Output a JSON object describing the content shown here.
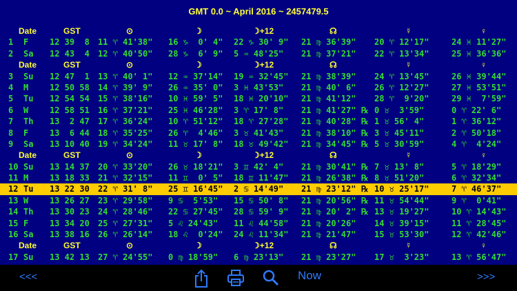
{
  "title": "GMT 0.0 ~ April 2016 ~ 2457479.5",
  "header": {
    "date": "Date",
    "gst": "GST",
    "sun": "⊙",
    "moon": "☽",
    "moon12": "☽+12",
    "node": "☊",
    "mercury": "☿",
    "venus": "♀"
  },
  "rows": [
    {
      "type": "header"
    },
    {
      "type": "data",
      "day": "1",
      "dow": "F",
      "gst": "12 39  8",
      "sun": "11 ♈ 41'38\"",
      "moon": "16 ♑  0' 4\"",
      "moon12": "22 ♑ 30' 9\"",
      "node": "21 ♍ 36'39\"",
      "mercury": "20 ♈ 12'17\"",
      "venus": "24 ♓ 11'27\""
    },
    {
      "type": "data",
      "day": "2",
      "dow": "Sa",
      "gst": "12 43  4",
      "sun": "12 ♈ 40'50\"",
      "moon": "28 ♑  6' 9\"",
      "moon12": "5 ♒ 48'25\"",
      "node": "21 ♍ 37'21\"",
      "mercury": "22 ♈ 13'34\"",
      "venus": "25 ♓ 36'36\""
    },
    {
      "type": "header"
    },
    {
      "type": "data",
      "day": "3",
      "dow": "Su",
      "gst": "12 47  1",
      "sun": "13 ♈ 40' 1\"",
      "moon": "12 ♒ 37'14\"",
      "moon12": "19 ♒ 32'45\"",
      "node": "21 ♍ 38'39\"",
      "mercury": "24 ♈ 13'45\"",
      "venus": "26 ♓ 39'44\""
    },
    {
      "type": "data",
      "day": "4",
      "dow": "M",
      "gst": "12 50 58",
      "sun": "14 ♈ 39' 9\"",
      "moon": "26 ♒ 35' 0\"",
      "moon12": "3 ♓ 43'53\"",
      "node": "21 ♍ 40' 6\"",
      "mercury": "26 ♈ 12'27\"",
      "venus": "27 ♓ 53'51\""
    },
    {
      "type": "data",
      "day": "5",
      "dow": "Tu",
      "gst": "12 54 54",
      "sun": "15 ♈ 38'16\"",
      "moon": "10 ♓ 59' 5\"",
      "moon12": "18 ♓ 20'10\"",
      "node": "21 ♍ 41'12\"",
      "mercury": "28 ♈  9'20\"",
      "venus": "29 ♓  7'59\""
    },
    {
      "type": "data",
      "day": "6",
      "dow": "W",
      "gst": "12 58 51",
      "sun": "16 ♈ 37'21\"",
      "moon": "25 ♓ 46'28\"",
      "moon12": "3 ♈ 17' 8\"",
      "node": "21 ♍ 41'27\" ℞",
      "mercury": "0 ♉  3'59\"",
      "venus": "0 ♈ 22' 6\""
    },
    {
      "type": "data",
      "day": "7",
      "dow": "Th",
      "gst": "13  2 47",
      "sun": "17 ♈ 36'24\"",
      "moon": "10 ♈ 51'12\"",
      "moon12": "18 ♈ 27'28\"",
      "node": "21 ♍ 40'28\" ℞",
      "mercury": "1 ♉ 56' 4\"",
      "venus": "1 ♈ 36'12\""
    },
    {
      "type": "data",
      "day": "8",
      "dow": "F",
      "gst": "13  6 44",
      "sun": "18 ♈ 35'25\"",
      "moon": "26 ♈  4'46\"",
      "moon12": "3 ♉ 41'43\"",
      "node": "21 ♍ 38'10\" ℞",
      "mercury": "3 ♉ 45'11\"",
      "venus": "2 ♈ 50'18\""
    },
    {
      "type": "data",
      "day": "9",
      "dow": "Sa",
      "gst": "13 10 40",
      "sun": "19 ♈ 34'24\"",
      "moon": "11 ♉ 17' 8\"",
      "moon12": "18 ♉ 49'42\"",
      "node": "21 ♍ 34'45\" ℞",
      "mercury": "5 ♉ 30'59\"",
      "venus": "4 ♈  4'24\""
    },
    {
      "type": "header"
    },
    {
      "type": "data",
      "day": "10",
      "dow": "Su",
      "gst": "13 14 37",
      "sun": "20 ♈ 33'20\"",
      "moon": "26 ♉ 18'21\"",
      "moon12": "3 ♊ 42' 4\"",
      "node": "21 ♍ 30'41\" ℞",
      "mercury": "7 ♉ 13' 8\"",
      "venus": "5 ♈ 18'29\""
    },
    {
      "type": "data",
      "day": "11",
      "dow": "M",
      "gst": "13 18 33",
      "sun": "21 ♈ 32'15\"",
      "moon": "11 ♊  0' 5\"",
      "moon12": "18 ♊ 11'47\"",
      "node": "21 ♍ 26'38\" ℞",
      "mercury": "8 ♉ 51'20\"",
      "venus": "6 ♈ 32'34\""
    },
    {
      "type": "data",
      "highlight": true,
      "day": "12",
      "dow": "Tu",
      "gst": "13 22 30",
      "sun": "22 ♈ 31' 8\"",
      "moon": "25 ♊ 16'45\"",
      "moon12": "2 ♋ 14'49\"",
      "node": "21 ♍ 23'12\" ℞",
      "mercury": "10 ♉ 25'17\"",
      "venus": "7 ♈ 46'37\""
    },
    {
      "type": "data",
      "day": "13",
      "dow": "W",
      "gst": "13 26 27",
      "sun": "23 ♈ 29'58\"",
      "moon": "9 ♋  5'53\"",
      "moon12": "15 ♋ 50' 8\"",
      "node": "21 ♍ 20'56\" ℞",
      "mercury": "11 ♉ 54'44\"",
      "venus": "9 ♈  0'41\""
    },
    {
      "type": "data",
      "day": "14",
      "dow": "Th",
      "gst": "13 30 23",
      "sun": "24 ♈ 28'46\"",
      "moon": "22 ♋ 27'45\"",
      "moon12": "28 ♋ 59' 9\"",
      "node": "21 ♍ 20' 2\" ℞",
      "mercury": "13 ♉ 19'27\"",
      "venus": "10 ♈ 14'43\""
    },
    {
      "type": "data",
      "day": "15",
      "dow": "F",
      "gst": "13 34 20",
      "sun": "25 ♈ 27'31\"",
      "moon": "5 ♌ 24'43\"",
      "moon12": "11 ♌ 44'58\"",
      "node": "21 ♍ 20'26\"",
      "mercury": "14 ♉ 39'15\"",
      "venus": "11 ♈ 28'45\""
    },
    {
      "type": "data",
      "day": "16",
      "dow": "Sa",
      "gst": "13 38 16",
      "sun": "26 ♈ 26'14\"",
      "moon": "18 ♌  0'24\"",
      "moon12": "24 ♌ 11'34\"",
      "node": "21 ♍ 21'47\"",
      "mercury": "15 ♉ 53'30\"",
      "venus": "12 ♈ 42'46\""
    },
    {
      "type": "header"
    },
    {
      "type": "data",
      "day": "17",
      "dow": "Su",
      "gst": "13 42 13",
      "sun": "27 ♈ 24'55\"",
      "moon": "0 ♍ 18'59\"",
      "moon12": "6 ♍ 23'13\"",
      "node": "21 ♍ 23'27\"",
      "mercury": "17 ♉  3'23\"",
      "venus": "13 ♈ 56'47\""
    }
  ],
  "toolbar": {
    "prev": "<<<",
    "next": ">>>",
    "now": "Now",
    "share_icon": "share-icon",
    "print_icon": "printer-icon",
    "search_icon": "search-icon"
  },
  "colors": {
    "background": "#000080",
    "data_text": "#33dd33",
    "header_text": "#ffff33",
    "highlight_row": "#ffcc00",
    "toolbar_blue": "#2f7bff"
  }
}
